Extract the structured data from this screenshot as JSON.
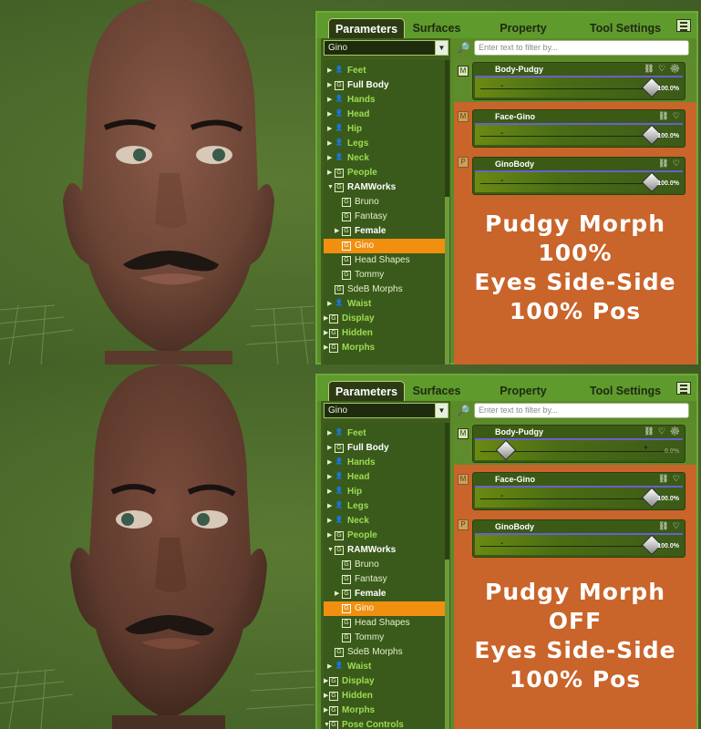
{
  "tabs": [
    "Parameters",
    "Surfaces",
    "Property Hierarchy",
    "Tool Settings"
  ],
  "figure_select": "Gino",
  "filter_placeholder": "Enter text to filter by...",
  "tree": [
    {
      "label": "Feet"
    },
    {
      "label": "Full Body"
    },
    {
      "label": "Hands"
    },
    {
      "label": "Head"
    },
    {
      "label": "Hip"
    },
    {
      "label": "Legs"
    },
    {
      "label": "Neck"
    },
    {
      "label": "People"
    },
    {
      "label": "RAMWorks"
    },
    {
      "label": "Bruno"
    },
    {
      "label": "Fantasy"
    },
    {
      "label": "Female"
    },
    {
      "label": "Gino"
    },
    {
      "label": "Head Shapes"
    },
    {
      "label": "Tommy"
    },
    {
      "label": "SdeB Morphs"
    },
    {
      "label": "Waist"
    },
    {
      "label": "Display"
    },
    {
      "label": "Hidden"
    },
    {
      "label": "Morphs"
    },
    {
      "label": "Pose Controls"
    }
  ],
  "top": {
    "sliders": [
      {
        "label": "Body-Pudgy",
        "value": "100.0%",
        "level": 1.0
      },
      {
        "label": "Face-Gino",
        "value": "100.0%",
        "level": 1.0
      },
      {
        "label": "GinoBody",
        "value": "100.0%",
        "level": 1.0
      }
    ],
    "caption": [
      "Pudgy Morph",
      "100%",
      "Eyes Side-Side",
      "100% Pos"
    ]
  },
  "bottom": {
    "sliders": [
      {
        "label": "Body-Pudgy",
        "value": "0.0%",
        "level": 0.0
      },
      {
        "label": "Face-Gino",
        "value": "100.0%",
        "level": 1.0
      },
      {
        "label": "GinoBody",
        "value": "100.0%",
        "level": 1.0
      }
    ],
    "caption": [
      "Pudgy Morph",
      "OFF",
      "Eyes Side-Side",
      "100% Pos"
    ]
  },
  "colors": {
    "accent_orange": "#f08f10",
    "panel_green": "#5a8a2a",
    "caption_bg": "#c9642a"
  }
}
